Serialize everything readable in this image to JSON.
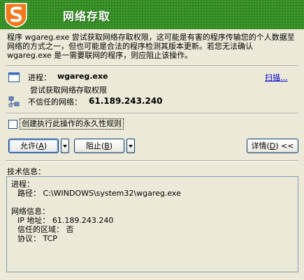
{
  "header": {
    "title": "网络存取"
  },
  "description": "程序 wgareg.exe 尝试获取网络存取权限，这可能是有害的程序传输您的个人数据至网络的方式之一，但也可能是合法的程序检测其版本更新。若您无法确认 wgareg.exe 是一需要联网的程序，则应阻止该操作。",
  "process": {
    "label": "进程：",
    "name": "wgareg.exe",
    "scan_link": "扫描...",
    "activity": "尝试获取网络存取权限",
    "net_label": "不信任的网络：",
    "ip": "61.189.243.240"
  },
  "rule": {
    "checkbox_label": "创建执行此操作的永久性规则",
    "checked": false
  },
  "buttons": {
    "allow_text": "允许(",
    "allow_key": "A",
    "allow_end": ")",
    "block_text": "阻止(",
    "block_key": "B",
    "block_end": ")",
    "details_text": "详情(",
    "details_key": "D",
    "details_end": ") <<"
  },
  "tech": {
    "label": "技术信息：",
    "process_header": "进程：",
    "path_line": "路径： C:\\WINDOWS\\system32\\wgareg.exe",
    "network_header": "网络信息：",
    "ip_line": "IP 地址： 61.189.243.240",
    "zone_line": "信任的区域： 否",
    "protocol_line": "协议： TCP"
  },
  "colors": {
    "header_green": "#2F8A1E",
    "logo_orange": "#F07A1A",
    "link_blue": "#0000CC"
  }
}
